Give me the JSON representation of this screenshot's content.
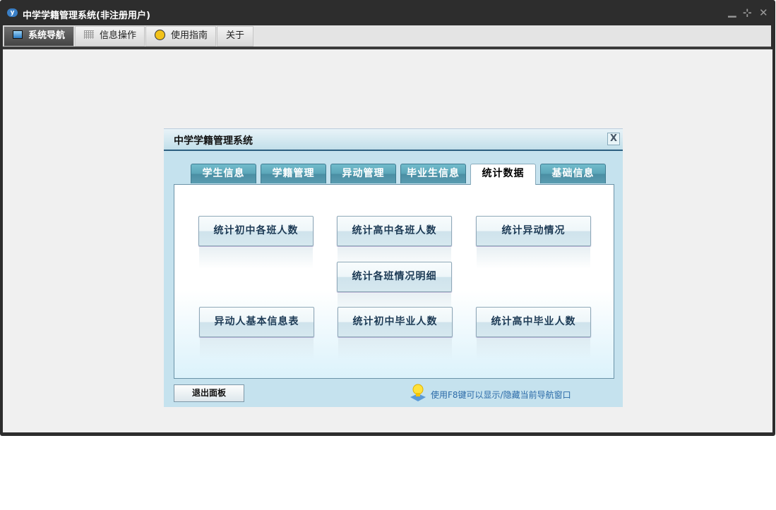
{
  "window": {
    "title": "中学学籍管理系统(非注册用户)",
    "logo": "yf",
    "controls": {
      "minimize": "▁",
      "restore": "⊹",
      "close": "✕"
    }
  },
  "menu": {
    "tabs": [
      {
        "label": "系统导航",
        "icon": "monitor-icon"
      },
      {
        "label": "信息操作",
        "icon": "grid-icon"
      },
      {
        "label": "使用指南",
        "icon": "help-icon"
      },
      {
        "label": "关于"
      }
    ],
    "active": 0
  },
  "dialog": {
    "title": "中学学籍管理系统",
    "close": "X",
    "tabs": [
      "学生信息",
      "学籍管理",
      "异动管理",
      "毕业生信息",
      "统计数据",
      "基础信息"
    ],
    "active_tab": "统计数据",
    "buttons": [
      "统计初中各班人数",
      "统计高中各班人数",
      "统计异动情况",
      "统计各班情况明细",
      "异动人基本信息表",
      "统计初中毕业人数",
      "统计高中毕业人数"
    ],
    "exit": "退出面板",
    "tip": "使用F8键可以显示/隐藏当前导航窗口"
  }
}
